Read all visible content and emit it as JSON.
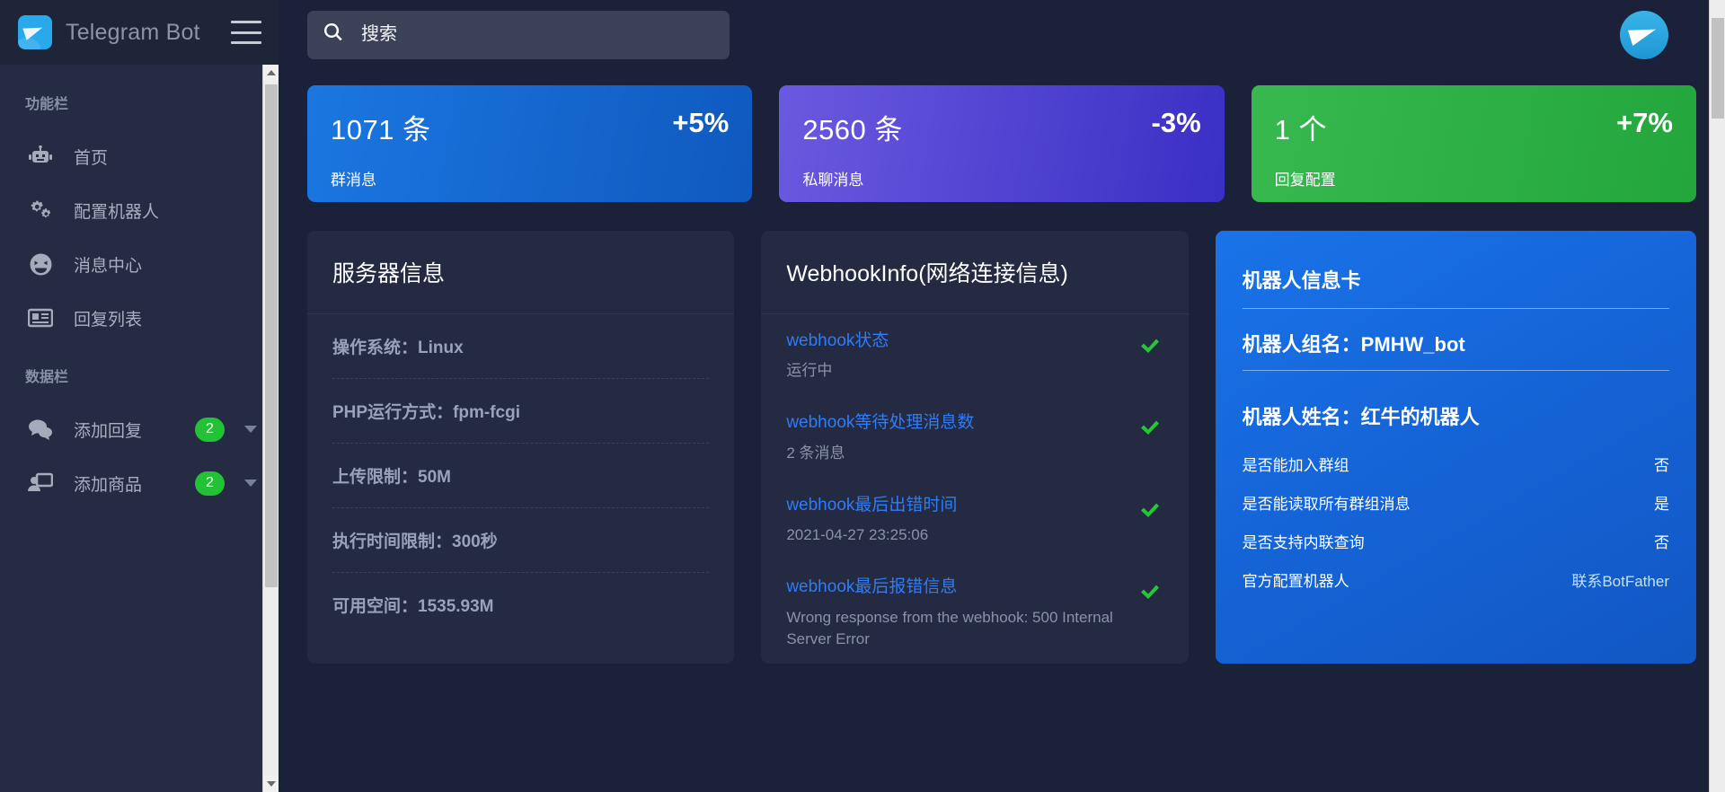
{
  "brand": {
    "title": "Telegram Bot",
    "logo_icon": "telegram-logo-icon",
    "menu_icon": "hamburger-menu-icon"
  },
  "sidebar": {
    "sections": [
      {
        "heading": "功能栏",
        "items": [
          {
            "label": "首页",
            "icon": "robot-icon"
          },
          {
            "label": "配置机器人",
            "icon": "gears-icon"
          },
          {
            "label": "消息中心",
            "icon": "laughing-face-icon"
          },
          {
            "label": "回复列表",
            "icon": "newspaper-icon"
          }
        ]
      },
      {
        "heading": "数据栏",
        "items": [
          {
            "label": "添加回复",
            "icon": "chat-bubbles-icon",
            "badge": "2",
            "caret": true
          },
          {
            "label": "添加商品",
            "icon": "user-screen-icon",
            "badge": "2",
            "caret": true
          }
        ]
      }
    ]
  },
  "topbar": {
    "search_placeholder": "搜索",
    "search_value": "",
    "search_icon": "search-icon",
    "avatar_icon": "telegram-avatar-icon"
  },
  "stats": [
    {
      "value": "1071 条",
      "percent": "+5%",
      "subtitle": "群消息",
      "color": "#1565d8"
    },
    {
      "value": "2560 条",
      "percent": "-3%",
      "subtitle": "私聊消息",
      "color": "#5b4ad6"
    },
    {
      "value": "1 个",
      "percent": "+7%",
      "subtitle": "回复配置",
      "color": "#2eb14a"
    }
  ],
  "server_panel": {
    "title": "服务器信息",
    "rows": [
      "操作系统：Linux",
      "PHP运行方式：fpm-fcgi",
      "上传限制：50M",
      "执行时间限制：300秒",
      "可用空间：1535.93M"
    ]
  },
  "webhook_panel": {
    "title": "WebhookInfo(网络连接信息)",
    "rows": [
      {
        "key": "webhook状态",
        "value": "运行中",
        "status": "ok"
      },
      {
        "key": "webhook等待处理消息数",
        "value": "2 条消息",
        "status": "ok"
      },
      {
        "key": "webhook最后出错时间",
        "value": "2021-04-27 23:25:06",
        "status": "ok"
      },
      {
        "key": "webhook最后报错信息",
        "value": "Wrong response from the webhook: 500 Internal Server Error",
        "status": "ok"
      }
    ]
  },
  "bot_card": {
    "title": "机器人信息卡",
    "group_name": "机器人组名：PMHW_bot",
    "bot_name": "机器人姓名：红牛的机器人",
    "lines": [
      {
        "label": "是否能加入群组",
        "value": "否",
        "link": false
      },
      {
        "label": "是否能读取所有群组消息",
        "value": "是",
        "link": false
      },
      {
        "label": "是否支持内联查询",
        "value": "否",
        "link": false
      },
      {
        "label": "官方配置机器人",
        "value": "联系BotFather",
        "link": true
      }
    ]
  },
  "colors": {
    "accent_blue": "#1565d8",
    "accent_purple": "#5b4ad6",
    "accent_green": "#2eb14a",
    "link_blue": "#2f7cf6",
    "check_green": "#22c934",
    "sidebar_bg": "#252b42",
    "page_bg": "#1b2138",
    "panel_bg": "#232a42"
  }
}
